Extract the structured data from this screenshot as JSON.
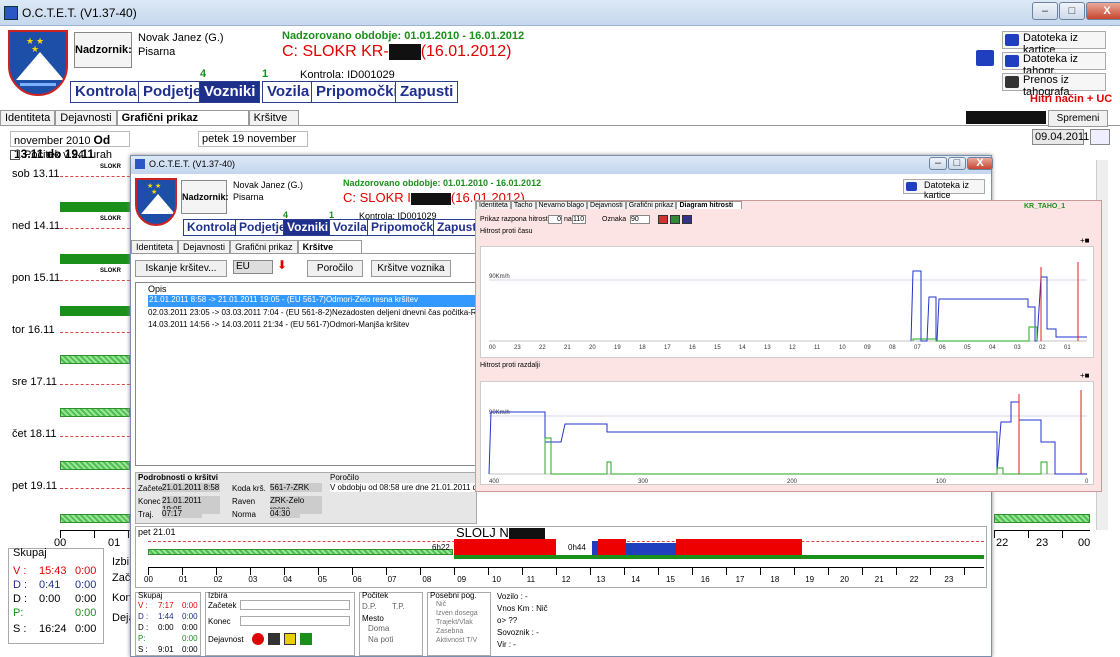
{
  "app": {
    "title": "O.C.T.E.T. (V1.37-40)"
  },
  "window_controls": {
    "minimize": "–",
    "maximize": "□",
    "close": "X"
  },
  "header": {
    "supervisor_label": "Nadzornik:",
    "name": "Novak Janez (G.)",
    "office": "Pisarna",
    "period": "Nadzorovano obdobje: 01.01.2010 - 16.01.2012",
    "card_prefix": "C: SLOKR KR-",
    "card_date": "(16.01.2012)",
    "control": "Kontrola: ID001029",
    "badge_vozniki": "4",
    "badge_vozila": "1"
  },
  "nav": [
    "Kontrola",
    "Podjetje",
    "Vozniki",
    "Vozila",
    "Pripomočki",
    "Zapusti"
  ],
  "side_buttons": [
    "Datoteka iz kartice",
    "Datoteka iz tahogr.",
    "Prenos iz tahografa"
  ],
  "fast_mode": "Hitri način + UC",
  "main_tabs": [
    "Identiteta",
    "Dejavnosti",
    "Grafični prikaz",
    "Kršitve"
  ],
  "change_button": "Spremeni",
  "period_bar": {
    "month": "november 2010",
    "range": "Od 13.11 do 19.11",
    "day": "petek 19 november",
    "date": "09.04.2011"
  },
  "start_24h": "Počitek v 24. urah",
  "day_rows": [
    "sob 13.11",
    "ned 14.11",
    "pon 15.11",
    "tor 16.11",
    "sre 17.11",
    "čet 18.11",
    "pet 19.11"
  ],
  "slokr_tag": "SLOKR",
  "axis_hours": [
    "00",
    "01"
  ],
  "axis_right": [
    "22",
    "23",
    "00"
  ],
  "summary_main": {
    "title": "Skupaj",
    "rows": [
      [
        "V :",
        "15:43",
        "0:00"
      ],
      [
        "D :",
        "0:41",
        "0:00"
      ],
      [
        "D :",
        "0:00",
        "0:00"
      ],
      [
        "P:",
        "",
        "0:00"
      ],
      [
        "S :",
        "16:24",
        "0:00"
      ]
    ],
    "izbira": "Izbi",
    "konec": "Kon",
    "deja": "Deja",
    "zac": "Zač"
  },
  "inner": {
    "title": "O.C.T.E.T. (V1.37-40)",
    "card_prefix": "C: SLOKR I",
    "tabs": [
      "Identiteta",
      "Dejavnosti",
      "Grafični prikaz",
      "Kršitve"
    ],
    "search_btn": "Iskanje kršitev...",
    "region": "EU",
    "report_btn": "Poročilo",
    "driver_violations_btn": "Kršitve voznika",
    "list_header": "Opis",
    "violations": [
      "21.01.2011 8:58 -> 21.01.2011 19:05 - (EU 561-7)Odmori-Zelo resna kršitev",
      "02.03.2011 23:05 -> 03.03.2011 7:04 - (EU 561-8-2)Nezadosten deljeni dnevni čas počitka-Resna kršitev",
      "14.03.2011 14:56 -> 14.03.2011 21:34 - (EU 561-7)Odmori-Manjša kršitev"
    ],
    "details": {
      "title": "Podrobnosti o kršitvi",
      "start_lbl": "Začetek",
      "start": "21.01.2011 8:58",
      "end_lbl": "Konec",
      "end": "21.01.2011 19:05",
      "dur_lbl": "Traj.",
      "dur": "07:17",
      "code_lbl": "Koda krš.",
      "code": "561-7-ZRK",
      "level_lbl": "Raven",
      "level": "ZRK-Zelo resna",
      "norm_lbl": "Norma",
      "norm": "04:30",
      "report_lbl": "Poročilo",
      "report": "V obdobju od 08:58 ure dne 21.01.2011 do 19:0"
    },
    "timeline": {
      "day": "pet 21.01",
      "title": "SLOLJ N",
      "mark1": "6h22",
      "mark2": "0h44",
      "hours": [
        "00",
        "01",
        "02",
        "03",
        "04",
        "05",
        "06",
        "07",
        "08",
        "09",
        "10",
        "11",
        "12",
        "13",
        "14",
        "15",
        "16",
        "17",
        "18",
        "19",
        "20",
        "21",
        "22",
        "23"
      ]
    },
    "summary": {
      "title": "Skupaj",
      "rows": [
        [
          "V :",
          "7:17",
          "0:00"
        ],
        [
          "D :",
          "1:44",
          "0:00"
        ],
        [
          "D :",
          "0:00",
          "0:00"
        ],
        [
          "P:",
          "",
          "0:00"
        ],
        [
          "S :",
          "9:01",
          "0:00"
        ]
      ]
    },
    "izbira": {
      "title": "Izbira",
      "start": "Začetek",
      "end": "Konec",
      "activity": "Dejavnost"
    },
    "pocitek": {
      "title": "Počitek",
      "dp": "D.P.",
      "tp": "T.P.",
      "mesto": "Mesto",
      "doma": "Doma",
      "na_poti": "Na poti"
    },
    "posebni": {
      "title": "Posebni pog.",
      "items": [
        "Nič",
        "Izven dosega",
        "Trajekt/Vlak",
        "Zasebna",
        "Aktivnost T/V"
      ]
    },
    "vehicle": {
      "vozilo": "Vozilo : -",
      "km": "Vnos Km : Nič",
      "arrow": "o> ??",
      "sovoznik": "Sovoznik : -",
      "vir": "Vir : -"
    }
  },
  "chart": {
    "tabs": [
      "Identiteta",
      "Tacho",
      "Nevarno blago",
      "Dejavnosti",
      "Grafični prikaz",
      "Diagram hitrosti"
    ],
    "range_label": "Prikaz razpona hitrosti",
    "range_from": "0",
    "range_to_lbl": "na",
    "range_to": "110",
    "mark_label": "Oznaka",
    "mark_value": "90",
    "tag": "KR_TAHO_1",
    "plot1_title": "Hitrost proti času",
    "plot1_label": "90Km/h",
    "plot2_title": "Hitrost proti razdalji",
    "plot2_label": "90Km/h",
    "plot1_ticks": [
      "00",
      "23",
      "22",
      "21",
      "20",
      "19",
      "18",
      "17",
      "16",
      "15",
      "14",
      "13",
      "12",
      "11",
      "10",
      "09",
      "08",
      "07",
      "06",
      "05",
      "04",
      "03",
      "02",
      "01"
    ],
    "plot2_ticks": [
      "400",
      "300",
      "200",
      "100",
      "0"
    ]
  }
}
